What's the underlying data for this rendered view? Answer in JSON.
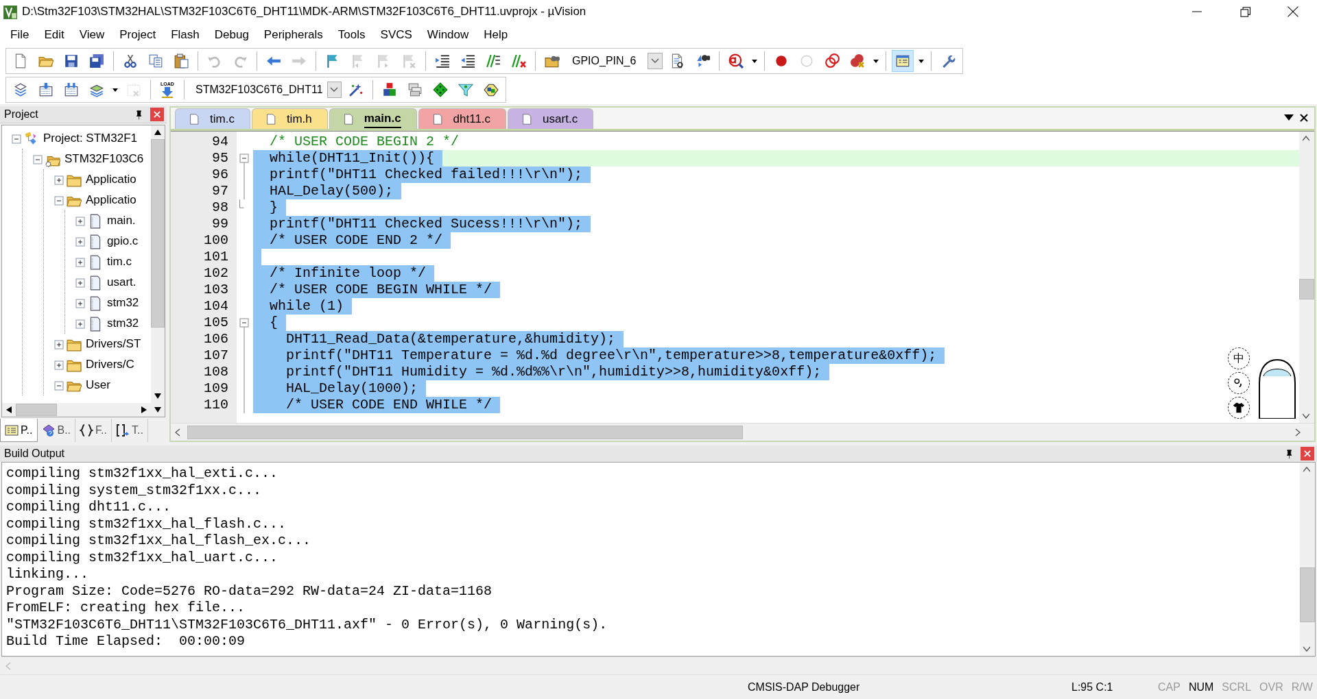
{
  "window": {
    "title": "D:\\Stm32F103\\STM32HAL\\STM32F103C6T6_DHT11\\MDK-ARM\\STM32F103C6T6_DHT11.uvprojx - µVision"
  },
  "menu": [
    {
      "label": "File"
    },
    {
      "label": "Edit"
    },
    {
      "label": "View"
    },
    {
      "label": "Project"
    },
    {
      "label": "Flash"
    },
    {
      "label": "Debug"
    },
    {
      "label": "Peripherals"
    },
    {
      "label": "Tools"
    },
    {
      "label": "SVCS"
    },
    {
      "label": "Window"
    },
    {
      "label": "Help"
    }
  ],
  "toolbar_1": [
    {
      "kind": "new",
      "disabled": false,
      "pressed": false
    },
    {
      "kind": "open",
      "disabled": false,
      "pressed": false
    },
    {
      "kind": "save",
      "disabled": false,
      "pressed": false
    },
    {
      "kind": "save-all",
      "disabled": false,
      "pressed": false
    },
    {
      "kind": "separator"
    },
    {
      "kind": "cut",
      "disabled": false,
      "pressed": false
    },
    {
      "kind": "copy",
      "disabled": false,
      "pressed": false
    },
    {
      "kind": "paste",
      "disabled": false,
      "pressed": false
    },
    {
      "kind": "separator"
    },
    {
      "kind": "undo",
      "disabled": true,
      "pressed": false
    },
    {
      "kind": "redo",
      "disabled": true,
      "pressed": false
    },
    {
      "kind": "separator"
    },
    {
      "kind": "back",
      "disabled": false,
      "pressed": false
    },
    {
      "kind": "forward",
      "disabled": true,
      "pressed": false
    },
    {
      "kind": "separator"
    },
    {
      "kind": "bookmark",
      "disabled": false,
      "pressed": false
    },
    {
      "kind": "bookmark-prev",
      "disabled": true,
      "pressed": false
    },
    {
      "kind": "bookmark-next",
      "disabled": true,
      "pressed": false
    },
    {
      "kind": "bookmark-clear",
      "disabled": true,
      "pressed": false
    },
    {
      "kind": "separator"
    },
    {
      "kind": "indent",
      "disabled": false,
      "pressed": false
    },
    {
      "kind": "unindent",
      "disabled": false,
      "pressed": false
    },
    {
      "kind": "comment",
      "disabled": false,
      "pressed": false
    },
    {
      "kind": "uncomment",
      "disabled": false,
      "pressed": false
    },
    {
      "kind": "separator"
    },
    {
      "kind": "find-in-files",
      "disabled": false,
      "pressed": false
    },
    {
      "kind": "combo",
      "value": "GPIO_PIN_6"
    },
    {
      "kind": "find",
      "disabled": false,
      "pressed": false
    },
    {
      "kind": "incremental-find",
      "disabled": false,
      "pressed": false
    },
    {
      "kind": "separator"
    },
    {
      "kind": "debug",
      "disabled": false,
      "pressed": false
    },
    {
      "kind": "dropdown"
    },
    {
      "kind": "separator"
    },
    {
      "kind": "breakpoint",
      "disabled": false,
      "pressed": false
    },
    {
      "kind": "breakpoint-enable",
      "disabled": true,
      "pressed": false
    },
    {
      "kind": "breakpoints-disable",
      "disabled": false,
      "pressed": false
    },
    {
      "kind": "breakpoints-kill",
      "disabled": false,
      "pressed": false
    },
    {
      "kind": "dropdown"
    },
    {
      "kind": "separator"
    },
    {
      "kind": "window",
      "disabled": false,
      "pressed": true
    },
    {
      "kind": "dropdown"
    },
    {
      "kind": "separator"
    },
    {
      "kind": "wrench",
      "disabled": false,
      "pressed": false
    }
  ],
  "toolbar_2": [
    {
      "kind": "translate",
      "disabled": false
    },
    {
      "kind": "build",
      "disabled": false
    },
    {
      "kind": "rebuild",
      "disabled": false
    },
    {
      "kind": "batch-build",
      "disabled": false
    },
    {
      "kind": "dropdown"
    },
    {
      "kind": "stop-build",
      "disabled": true
    },
    {
      "kind": "separator"
    },
    {
      "kind": "download",
      "label": "LOAD",
      "disabled": false
    },
    {
      "kind": "separator"
    },
    {
      "kind": "combo",
      "value": "STM32F103C6T6_DHT11"
    },
    {
      "kind": "target-options",
      "disabled": false
    },
    {
      "kind": "separator"
    },
    {
      "kind": "components",
      "disabled": false
    },
    {
      "kind": "environment",
      "disabled": false
    },
    {
      "kind": "diamond",
      "disabled": false
    },
    {
      "kind": "funnel",
      "disabled": false
    },
    {
      "kind": "packs",
      "disabled": false
    }
  ],
  "project_panel": {
    "title": "Project",
    "tree": [
      {
        "kind": "project",
        "label": "Project: STM32F1",
        "expanded": true,
        "children": [
          {
            "kind": "target",
            "label": "STM32F103C6",
            "expanded": true,
            "children": [
              {
                "kind": "folder",
                "label": "Applicatio",
                "expanded": false
              },
              {
                "kind": "folder",
                "label": "Applicatio",
                "expanded": true,
                "children": [
                  {
                    "kind": "file",
                    "label": "main.",
                    "expanded": false
                  },
                  {
                    "kind": "file",
                    "label": "gpio.c",
                    "expanded": false
                  },
                  {
                    "kind": "file",
                    "label": "tim.c",
                    "expanded": false
                  },
                  {
                    "kind": "file",
                    "label": "usart.",
                    "expanded": false
                  },
                  {
                    "kind": "file",
                    "label": "stm32",
                    "expanded": false
                  },
                  {
                    "kind": "file",
                    "label": "stm32",
                    "expanded": false
                  }
                ]
              },
              {
                "kind": "folder",
                "label": "Drivers/ST",
                "expanded": false
              },
              {
                "kind": "folder",
                "label": "Drivers/C",
                "expanded": false
              },
              {
                "kind": "folder",
                "label": "User",
                "expanded": true
              }
            ]
          }
        ]
      }
    ],
    "tabs": [
      {
        "kind": "project",
        "label": "P..",
        "selected": true
      },
      {
        "kind": "books",
        "label": "B..",
        "selected": false
      },
      {
        "kind": "functions",
        "label": "F..",
        "selected": false
      },
      {
        "kind": "templates",
        "label": "T..",
        "selected": false
      }
    ]
  },
  "editor": {
    "tabs": [
      {
        "label": "tim.c",
        "color": "#c8d6f4",
        "selected": false
      },
      {
        "label": "tim.h",
        "color": "#fbe18c",
        "selected": false
      },
      {
        "label": "main.c",
        "color": "#c5d6a6",
        "selected": true
      },
      {
        "label": "dht11.c",
        "color": "#f2a3a3",
        "selected": false
      },
      {
        "label": "usart.c",
        "color": "#c7b3e3",
        "selected": false
      }
    ],
    "lines": [
      {
        "number": "94",
        "text": "  /* USER CODE BEGIN 2 */",
        "kind": "comment",
        "selected": false,
        "current": false,
        "foldable": false,
        "fold_end": false
      },
      {
        "number": "95",
        "text": "  while(DHT11_Init()){",
        "kind": "code",
        "selected": true,
        "current": true,
        "foldable": true,
        "fold_end": false
      },
      {
        "number": "96",
        "text": "  printf(\"DHT11 Checked failed!!!\\r\\n\");",
        "kind": "code",
        "selected": true,
        "current": false,
        "foldable": false,
        "fold_end": false
      },
      {
        "number": "97",
        "text": "  HAL_Delay(500);",
        "kind": "code",
        "selected": true,
        "current": false,
        "foldable": false,
        "fold_end": false
      },
      {
        "number": "98",
        "text": "  }",
        "kind": "code",
        "selected": true,
        "current": false,
        "foldable": false,
        "fold_end": true
      },
      {
        "number": "99",
        "text": "  printf(\"DHT11 Checked Sucess!!!\\r\\n\");",
        "kind": "code",
        "selected": true,
        "current": false,
        "foldable": false,
        "fold_end": false
      },
      {
        "number": "100",
        "text": "  /* USER CODE END 2 */",
        "kind": "comment",
        "selected": true,
        "current": false,
        "foldable": false,
        "fold_end": false
      },
      {
        "number": "101",
        "kind": "code",
        "selected": true,
        "current": false,
        "foldable": false,
        "fold_end": false
      },
      {
        "number": "102",
        "text": "  /* Infinite loop */",
        "kind": "comment",
        "selected": true,
        "current": false,
        "foldable": false,
        "fold_end": false
      },
      {
        "number": "103",
        "text": "  /* USER CODE BEGIN WHILE */",
        "kind": "comment",
        "selected": true,
        "current": false,
        "foldable": false,
        "fold_end": false
      },
      {
        "number": "104",
        "text": "  while (1)",
        "kind": "code",
        "selected": true,
        "current": false,
        "foldable": false,
        "fold_end": false
      },
      {
        "number": "105",
        "text": "  {",
        "kind": "code",
        "selected": true,
        "current": false,
        "foldable": true,
        "fold_end": false
      },
      {
        "number": "106",
        "text": "    DHT11_Read_Data(&temperature,&humidity);",
        "kind": "code",
        "selected": true,
        "current": false,
        "foldable": false,
        "fold_end": false
      },
      {
        "number": "107",
        "text": "    printf(\"DHT11 Temperature = %d.%d degree\\r\\n\",temperature>>8,temperature&0xff);",
        "kind": "code",
        "selected": true,
        "current": false,
        "foldable": false,
        "fold_end": false
      },
      {
        "number": "108",
        "text": "    printf(\"DHT11 Humidity = %d.%d%%\\r\\n\",humidity>>8,humidity&0xff);",
        "kind": "code",
        "selected": true,
        "current": false,
        "foldable": false,
        "fold_end": false
      },
      {
        "number": "109",
        "text": "    HAL_Delay(1000);",
        "kind": "code",
        "selected": true,
        "current": false,
        "foldable": false,
        "fold_end": false
      },
      {
        "number": "110",
        "text": "    /* USER CODE END WHILE */",
        "kind": "comment",
        "selected": true,
        "current": false,
        "foldable": false,
        "fold_end": false
      }
    ]
  },
  "ime": {
    "label": "中"
  },
  "build_output": {
    "title": "Build Output",
    "lines": [
      "compiling stm32f1xx_hal_exti.c...",
      "compiling system_stm32f1xx.c...",
      "compiling dht11.c...",
      "compiling stm32f1xx_hal_flash.c...",
      "compiling stm32f1xx_hal_flash_ex.c...",
      "compiling stm32f1xx_hal_uart.c...",
      "linking...",
      "Program Size: Code=5276 RO-data=292 RW-data=24 ZI-data=1168",
      "FromELF: creating hex file...",
      "\"STM32F103C6T6_DHT11\\STM32F103C6T6_DHT11.axf\" - 0 Error(s), 0 Warning(s).",
      "Build Time Elapsed:  00:00:09"
    ]
  },
  "status_bar": {
    "debugger": "CMSIS-DAP Debugger",
    "position": "L:95 C:1",
    "indicators": [
      {
        "label": "CAP",
        "on": false
      },
      {
        "label": "NUM",
        "on": true
      },
      {
        "label": "SCRL",
        "on": false
      },
      {
        "label": "OVR",
        "on": false
      },
      {
        "label": "R/W",
        "on": false
      }
    ]
  }
}
